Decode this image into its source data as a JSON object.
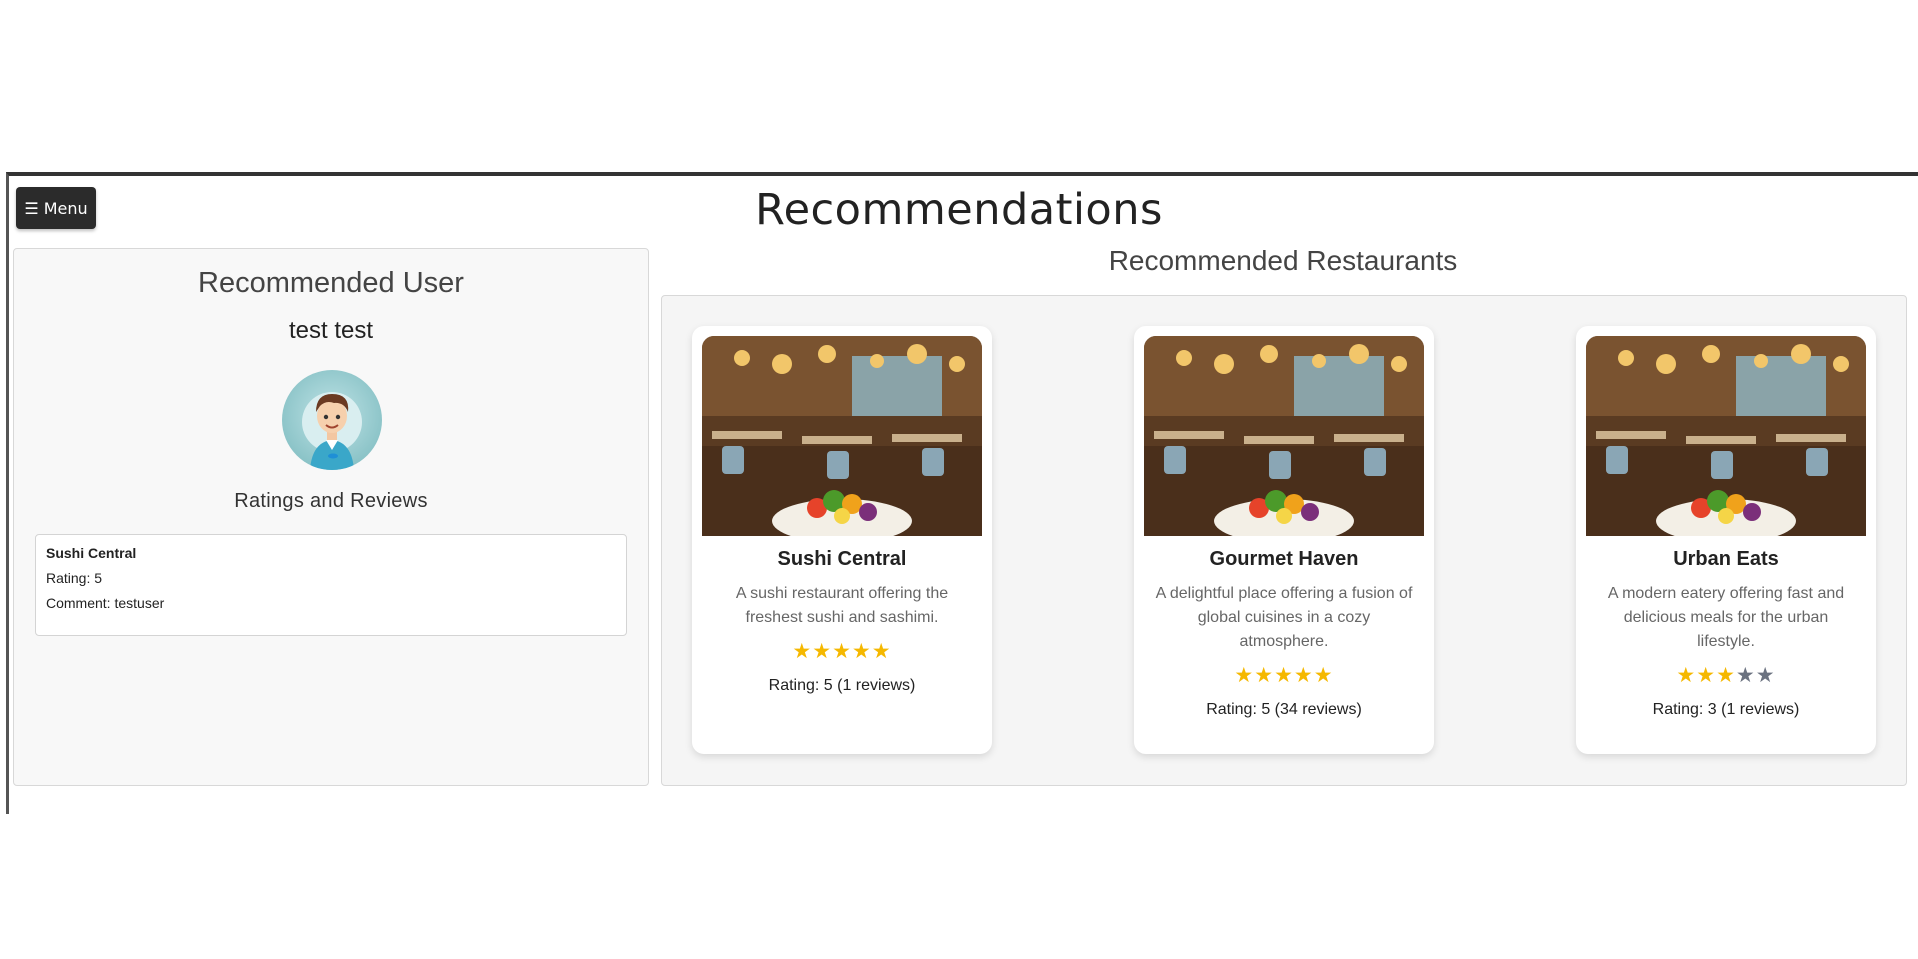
{
  "menu": {
    "label": "☰ Menu"
  },
  "page": {
    "title": "Recommendations"
  },
  "user_panel": {
    "heading": "Recommended User",
    "name": "test test",
    "reviews_heading": "Ratings and Reviews",
    "reviews": [
      {
        "restaurant": "Sushi Central",
        "rating": "Rating: 5",
        "comment": "Comment: testuser"
      }
    ]
  },
  "restaurants": {
    "heading": "Recommended Restaurants",
    "cards": [
      {
        "name": "Sushi Central",
        "description": "A sushi restaurant offering the freshest sushi and sashimi.",
        "stars": 5,
        "rating_text": "Rating: 5 (1 reviews)"
      },
      {
        "name": "Gourmet Haven",
        "description": "A delightful place offering a fusion of global cuisines in a cozy atmosphere.",
        "stars": 5,
        "rating_text": "Rating: 5 (34 reviews)"
      },
      {
        "name": "Urban Eats",
        "description": "A modern eatery offering fast and delicious meals for the urban lifestyle.",
        "stars": 3,
        "rating_text": "Rating: 3 (1 reviews)"
      }
    ]
  },
  "colors": {
    "star_filled": "#f5b800",
    "star_empty": "#6b7280",
    "menu_bg": "#2b2b2b"
  }
}
